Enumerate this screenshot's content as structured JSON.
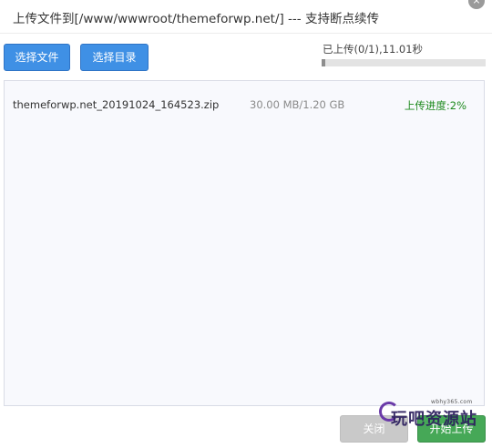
{
  "dialog": {
    "title": "上传文件到[/www/wwwroot/themeforwp.net/] --- 支持断点续传",
    "close_icon": "×"
  },
  "toolbar": {
    "choose_file_label": "选择文件",
    "choose_dir_label": "选择目录"
  },
  "progress": {
    "summary": "已上传(0/1),11.01秒",
    "fraction": 0.02
  },
  "files": [
    {
      "name": "themeforwp.net_20191024_164523.zip",
      "size": "30.00 MB/1.20 GB",
      "status": "上传进度:2%"
    }
  ],
  "footer": {
    "close_label": "关闭",
    "start_label": "开始上传"
  },
  "watermark": {
    "site": "wbhy365.com",
    "text": "玩吧资源站"
  },
  "colors": {
    "primary_button": "#3f90e5",
    "start_button": "#46a857",
    "disabled_button": "#c9c9c9",
    "status_text": "#1e8a1e",
    "progress_fill": "#8d8d8d"
  }
}
